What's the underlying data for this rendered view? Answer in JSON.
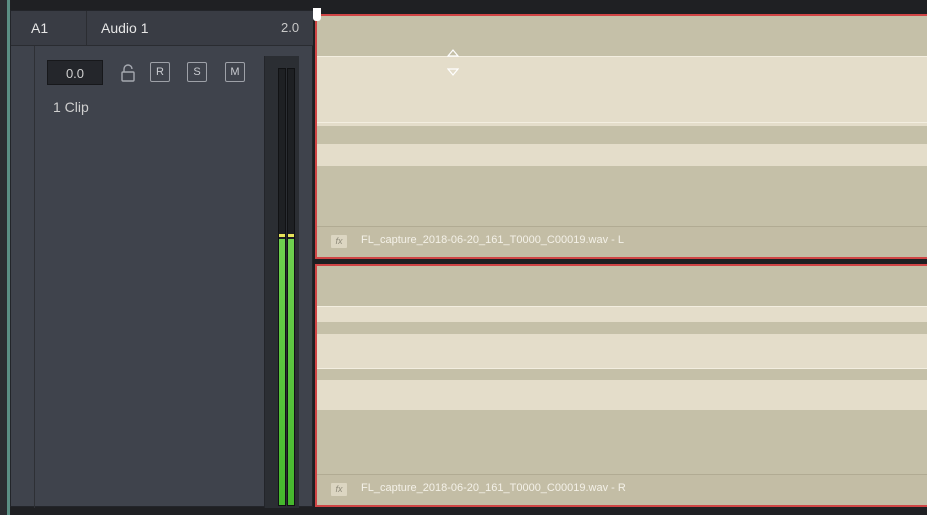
{
  "track": {
    "id": "A1",
    "name": "Audio 1",
    "format": "2.0",
    "volume": "0.0",
    "buttons": {
      "record": "R",
      "solo": "S",
      "mute": "M"
    },
    "clip_count": "1 Clip"
  },
  "meter": {
    "level_fraction": 0.61,
    "peak_fraction": 0.615,
    "fill_color": "#4cbc33",
    "peak_color": "#e7e35a"
  },
  "clips": [
    {
      "label": "FL_capture_2018-06-20_161_T0000_C00019.wav - L",
      "fx": "fx"
    },
    {
      "label": "FL_capture_2018-06-20_161_T0000_C00019.wav - R",
      "fx": "fx"
    }
  ],
  "colors": {
    "clip_border": "#d04545",
    "clip_fill": "#c5c0a8",
    "track_accent": "#5b8f84"
  },
  "icons": [
    "lock-icon",
    "fade-up-icon",
    "fade-down-icon",
    "fx-icon",
    "playhead-marker-icon"
  ]
}
